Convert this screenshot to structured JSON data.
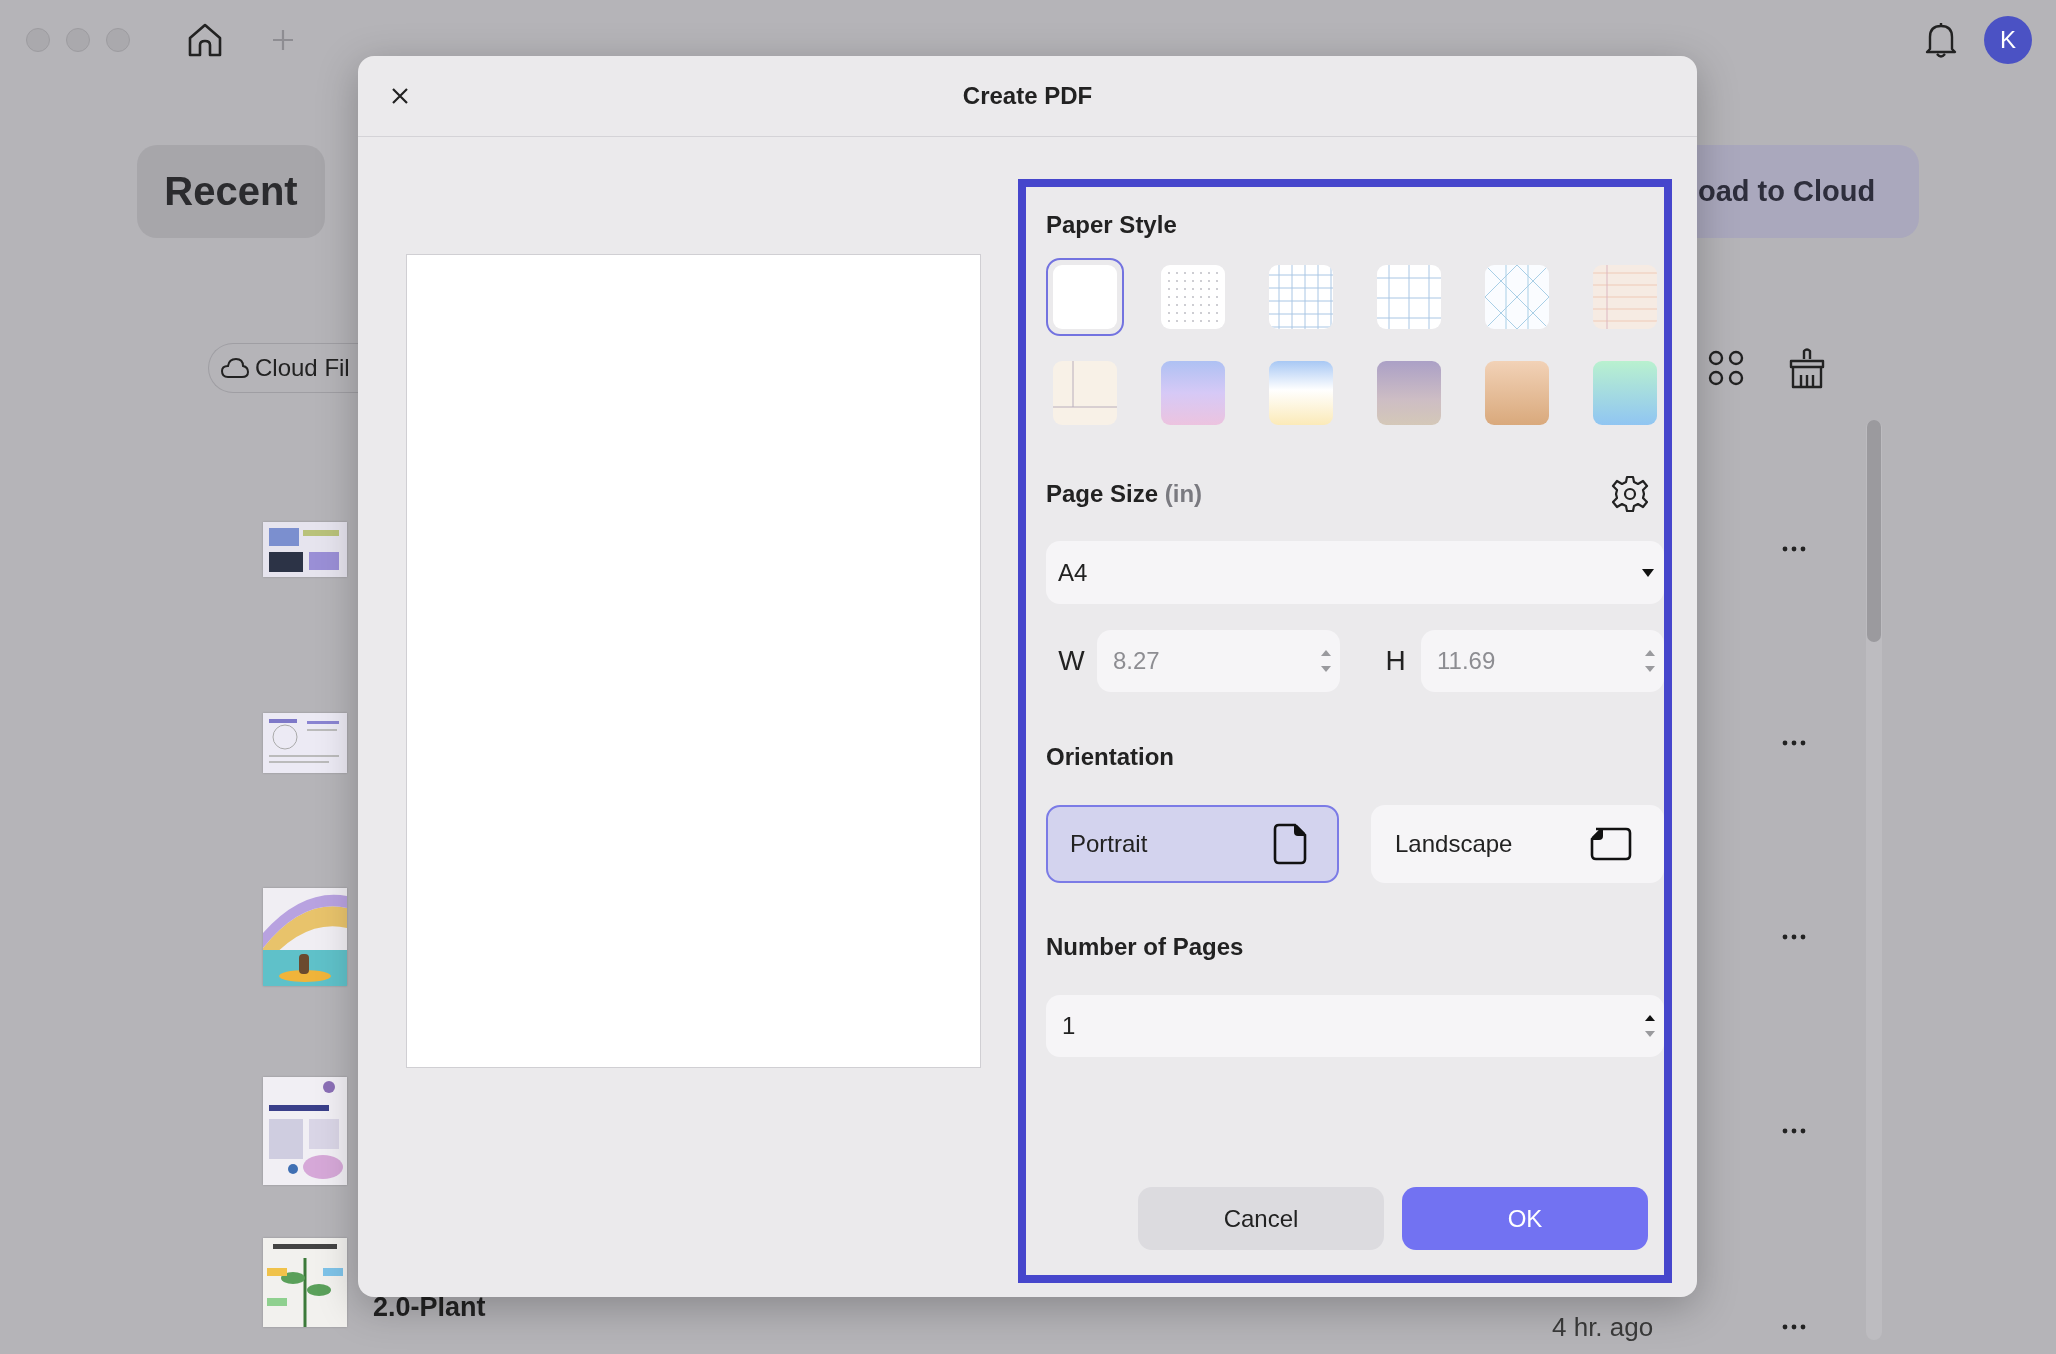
{
  "topbar": {
    "avatar": "K"
  },
  "library": {
    "recent_button": "Recent",
    "cloud_button": "oad to Cloud",
    "filter_chip": "Cloud Fil",
    "files": [
      {
        "kind": "picture"
      },
      {
        "kind": "picture"
      },
      {
        "kind": "picture"
      },
      {
        "kind": "picture"
      },
      {
        "kind": "picture",
        "name": "2.0-Plant",
        "time": "4 hr. ago"
      }
    ]
  },
  "dialog": {
    "title": "Create PDF",
    "paper_style": {
      "title": "Paper Style",
      "options": [
        {
          "kind": "blank",
          "selected": true
        },
        {
          "kind": "dots",
          "selected": false
        },
        {
          "kind": "grid",
          "selected": false
        },
        {
          "kind": "large-grid",
          "selected": false
        },
        {
          "kind": "isometric",
          "selected": false
        },
        {
          "kind": "lined",
          "selected": false
        },
        {
          "kind": "cornell",
          "selected": false
        },
        {
          "kind": "lilac",
          "selected": false
        },
        {
          "kind": "sky",
          "selected": false
        },
        {
          "kind": "mauve",
          "selected": false
        },
        {
          "kind": "peach",
          "selected": false
        },
        {
          "kind": "mint",
          "selected": false
        }
      ]
    },
    "page_size": {
      "title": "Page Size",
      "unit": "(in)",
      "preset": "A4",
      "width": {
        "label": "W",
        "value": "8.27",
        "disabled": true
      },
      "height": {
        "label": "H",
        "value": "11.69",
        "disabled": true
      }
    },
    "orientation": {
      "title": "Orientation",
      "options": [
        {
          "kind": "portrait",
          "label": "Portrait",
          "selected": true
        },
        {
          "kind": "landscape",
          "label": "Landscape",
          "selected": false
        }
      ]
    },
    "pages": {
      "title": "Number of Pages",
      "value": "1"
    },
    "buttons": [
      {
        "kind": "secondary",
        "label": "Cancel"
      },
      {
        "kind": "primary",
        "label": "OK"
      }
    ]
  }
}
